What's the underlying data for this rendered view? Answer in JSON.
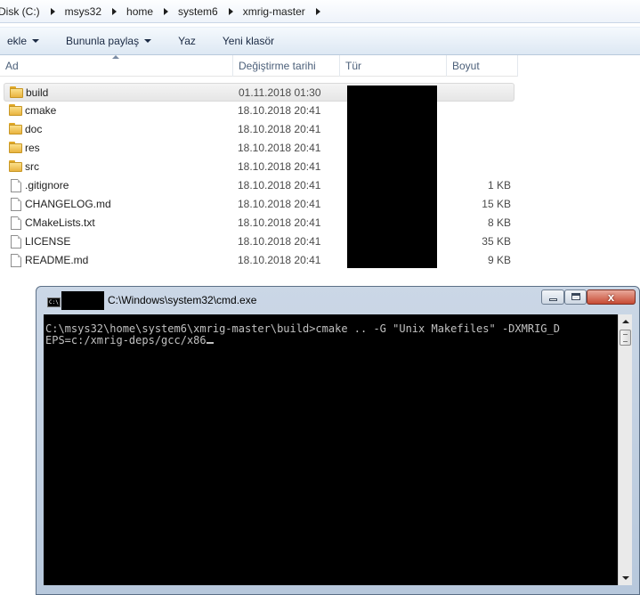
{
  "breadcrumb": [
    "Disk (C:)",
    "msys32",
    "home",
    "system6",
    "xmrig-master"
  ],
  "toolbar": {
    "include_label": "ekle",
    "share_label": "Bununla paylaş",
    "burn_label": "Yaz",
    "new_folder_label": "Yeni klasör"
  },
  "columns": {
    "name": "Ad",
    "date": "Değiştirme tarihi",
    "type": "Tür",
    "size": "Boyut"
  },
  "files": [
    {
      "name": "build",
      "date": "01.11.2018 01:30",
      "size": "",
      "kind": "folder"
    },
    {
      "name": "cmake",
      "date": "18.10.2018 20:41",
      "size": "",
      "kind": "folder"
    },
    {
      "name": "doc",
      "date": "18.10.2018 20:41",
      "size": "",
      "kind": "folder"
    },
    {
      "name": "res",
      "date": "18.10.2018 20:41",
      "size": "",
      "kind": "folder"
    },
    {
      "name": "src",
      "date": "18.10.2018 20:41",
      "size": "",
      "kind": "folder"
    },
    {
      "name": ".gitignore",
      "date": "18.10.2018 20:41",
      "size": "1 KB",
      "kind": "file"
    },
    {
      "name": "CHANGELOG.md",
      "date": "18.10.2018 20:41",
      "size": "15 KB",
      "kind": "file"
    },
    {
      "name": "CMakeLists.txt",
      "date": "18.10.2018 20:41",
      "size": "8 KB",
      "kind": "file"
    },
    {
      "name": "LICENSE",
      "date": "18.10.2018 20:41",
      "size": "35 KB",
      "kind": "file"
    },
    {
      "name": "README.md",
      "date": "18.10.2018 20:41",
      "size": "9 KB",
      "kind": "file"
    }
  ],
  "cmd": {
    "icon_text": "C:\\",
    "title": "C:\\Windows\\system32\\cmd.exe",
    "lines": [
      "C:\\msys32\\home\\system6\\xmrig-master\\build>cmake .. -G \"Unix Makefiles\" -DXMRIG_D",
      "EPS=c:/xmrig-deps/gcc/x86"
    ],
    "close_glyph": "x"
  }
}
